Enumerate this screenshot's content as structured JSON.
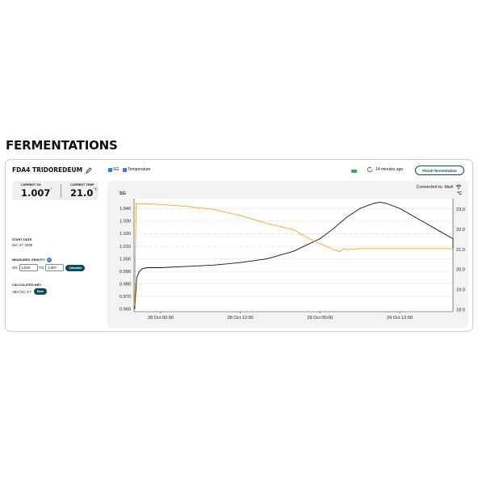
{
  "page": {
    "title": "FERMENTATIONS"
  },
  "fermentation": {
    "name": "FDA4 TRIDOREDEUM",
    "current_sg": {
      "label": "CURRENT SG",
      "value": "1.007",
      "unit": "°"
    },
    "current_temp": {
      "label": "CURRENT TEMP",
      "value": "21.0",
      "unit": "°C"
    },
    "start_date": {
      "label": "START DATE",
      "value": "Oct. 27, 2025"
    },
    "measured_gravity": {
      "label": "MEASURED GRAVITY",
      "og_label": "OG",
      "og_value": "1,043",
      "fg_label": "FG",
      "fg_value": "1,007",
      "button": "Calculate"
    },
    "abv": {
      "label": "CALCULATED ABV",
      "text": "ABV [%]: 4.7",
      "button": "Save"
    }
  },
  "toolbar": {
    "sg_checkbox": {
      "label": "SG",
      "checked": true
    },
    "temp_checkbox": {
      "label": "Temperature",
      "checked": true
    },
    "battery_color": "#2bb24c",
    "last_seen": "14 minutes ago",
    "finish_button": "Finish fermentation"
  },
  "connection": {
    "text": "Connected to: fdа4"
  },
  "chart_data": {
    "type": "line",
    "x_ticks": [
      "28 Oct 00:00",
      "28 Oct 12:00",
      "29 Oct 00:00",
      "29 Oct 12:00"
    ],
    "x_range_hours": [
      -4,
      44
    ],
    "y_left": {
      "label": "SG",
      "ticks": [
        "0.960",
        "0.970",
        "0.980",
        "0.990",
        "1.000",
        "1.010",
        "1.020",
        "1.030",
        "1.040"
      ],
      "range": [
        0.958,
        1.044
      ]
    },
    "y_right": {
      "label": "°C",
      "ticks": [
        "18.0",
        "19.0",
        "20.0",
        "21.0",
        "22.0",
        "23.0"
      ],
      "range": [
        17.9,
        23.3
      ]
    },
    "grid": "horizontal dashed",
    "series": [
      {
        "name": "SG",
        "axis": "left",
        "color": "#111111",
        "points": [
          [
            -3.9,
            0.96
          ],
          [
            -3.6,
            0.985
          ],
          [
            -3.2,
            0.99
          ],
          [
            -2.8,
            0.992
          ],
          [
            -2,
            0.993
          ],
          [
            0,
            0.993
          ],
          [
            4,
            0.994
          ],
          [
            8,
            0.995
          ],
          [
            12,
            0.997
          ],
          [
            16,
            1.0
          ],
          [
            20,
            1.006
          ],
          [
            24,
            1.016
          ],
          [
            26,
            1.024
          ],
          [
            28,
            1.033
          ],
          [
            30,
            1.04
          ],
          [
            32,
            1.044
          ],
          [
            33,
            1.045
          ],
          [
            34,
            1.044
          ],
          [
            36,
            1.04
          ],
          [
            38,
            1.034
          ],
          [
            40,
            1.028
          ],
          [
            42,
            1.022
          ],
          [
            44,
            1.016
          ],
          [
            46,
            1.012
          ],
          [
            48,
            1.009
          ],
          [
            50,
            1.008
          ],
          [
            52,
            1.007
          ]
        ]
      },
      {
        "name": "Temperature",
        "axis": "right",
        "color": "#f5a623",
        "points": [
          [
            -3.9,
            18.2
          ],
          [
            -3.7,
            23.3
          ],
          [
            0,
            23.25
          ],
          [
            4,
            23.15
          ],
          [
            8,
            23.0
          ],
          [
            12,
            22.7
          ],
          [
            16,
            22.3
          ],
          [
            20,
            22.0
          ],
          [
            22,
            21.6
          ],
          [
            24,
            21.3
          ],
          [
            26,
            21.0
          ],
          [
            27,
            20.9
          ],
          [
            27.5,
            21.05
          ],
          [
            28,
            21.0
          ],
          [
            30,
            21.05
          ],
          [
            34,
            21.05
          ],
          [
            40,
            21.05
          ],
          [
            46,
            21.05
          ],
          [
            52,
            21.0
          ]
        ]
      }
    ]
  }
}
